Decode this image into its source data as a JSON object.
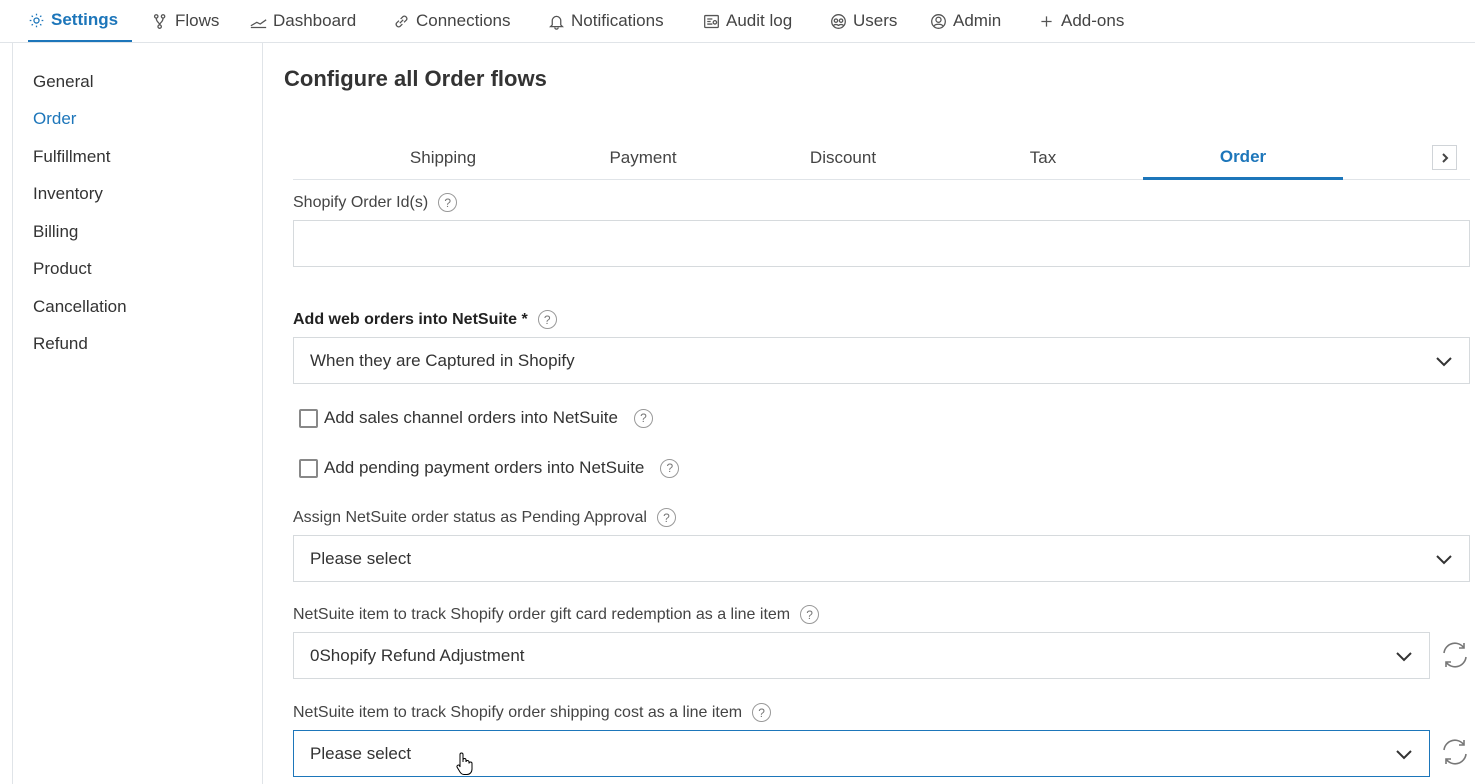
{
  "topnav": {
    "items": [
      {
        "label": "Settings",
        "icon": "gear-icon"
      },
      {
        "label": "Flows",
        "icon": "flow-icon"
      },
      {
        "label": "Dashboard",
        "icon": "dashboard-icon"
      },
      {
        "label": "Connections",
        "icon": "link-icon"
      },
      {
        "label": "Notifications",
        "icon": "bell-icon"
      },
      {
        "label": "Audit log",
        "icon": "audit-icon"
      },
      {
        "label": "Users",
        "icon": "users-icon"
      },
      {
        "label": "Admin",
        "icon": "admin-icon"
      },
      {
        "label": "Add-ons",
        "icon": "plus-icon"
      }
    ]
  },
  "sidebar": {
    "items": [
      {
        "label": "General"
      },
      {
        "label": "Order"
      },
      {
        "label": "Fulfillment"
      },
      {
        "label": "Inventory"
      },
      {
        "label": "Billing"
      },
      {
        "label": "Product"
      },
      {
        "label": "Cancellation"
      },
      {
        "label": "Refund"
      }
    ],
    "active": "Order"
  },
  "main": {
    "title": "Configure all Order flows",
    "tabs": [
      {
        "label": "Shipping"
      },
      {
        "label": "Payment"
      },
      {
        "label": "Discount"
      },
      {
        "label": "Tax"
      },
      {
        "label": "Order"
      }
    ],
    "active_tab": "Order",
    "fields": {
      "order_ids_label": "Shopify Order Id(s)",
      "order_ids_value": "",
      "web_orders_label": "Add web orders into NetSuite *",
      "web_orders_value": "When they are Captured in Shopify",
      "sales_channel_label": "Add sales channel orders into NetSuite",
      "pending_payment_label": "Add pending payment orders into NetSuite",
      "pending_approval_label": "Assign NetSuite order status as Pending Approval",
      "pending_approval_value": "Please select",
      "gift_card_label": "NetSuite item to track Shopify order gift card redemption as a line item",
      "gift_card_value": "0Shopify Refund Adjustment",
      "shipping_cost_label": "NetSuite item to track Shopify order shipping cost as a line item",
      "shipping_cost_value": "Please select"
    },
    "help_glyph": "?"
  },
  "colors": {
    "accent": "#1d76ba",
    "border": "#d6dadd"
  }
}
